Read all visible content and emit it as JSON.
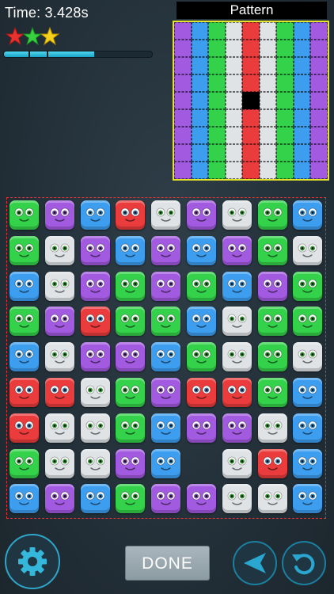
{
  "hud": {
    "timer": "Time: 3.428s",
    "stars": 3,
    "progress": 0.61
  },
  "pattern": {
    "title": "Pattern",
    "columns": [
      "purple",
      "blue",
      "green",
      "white",
      "red",
      "white",
      "green",
      "blue",
      "purple"
    ],
    "rows": 9,
    "empty_cell": [
      4,
      4
    ]
  },
  "board": {
    "empty_cells": [
      [
        7,
        5
      ]
    ],
    "grid": [
      [
        "green",
        "purple",
        "blue",
        "red",
        "white",
        "purple",
        "white",
        "green",
        "blue"
      ],
      [
        "green",
        "white",
        "purple",
        "blue",
        "purple",
        "blue",
        "purple",
        "green",
        "white"
      ],
      [
        "blue",
        "white",
        "purple",
        "green",
        "purple",
        "green",
        "blue",
        "purple",
        "green"
      ],
      [
        "green",
        "purple",
        "red",
        "green",
        "green",
        "blue",
        "white",
        "green",
        "green"
      ],
      [
        "blue",
        "white",
        "purple",
        "purple",
        "blue",
        "green",
        "white",
        "green",
        "white"
      ],
      [
        "red",
        "red",
        "white",
        "green",
        "purple",
        "red",
        "red",
        "green",
        "blue"
      ],
      [
        "red",
        "white",
        "white",
        "green",
        "blue",
        "purple",
        "purple",
        "white",
        "blue"
      ],
      [
        "green",
        "white",
        "white",
        "purple",
        "blue",
        "",
        "white",
        "red",
        "blue"
      ],
      [
        "blue",
        "purple",
        "blue",
        "green",
        "purple",
        "purple",
        "white",
        "white",
        "blue"
      ]
    ]
  },
  "colors": {
    "green": "#34d14a",
    "purple": "#a25ae0",
    "blue": "#3d9ef0",
    "red": "#ea3c3c",
    "white": "#dfe3e6",
    "accent": "#2fa6c9",
    "pattern_border": "#e4e42a"
  },
  "controls": {
    "done_label": "DONE",
    "settings_icon": "gear-icon",
    "send_icon": "arrow-left-icon",
    "undo_icon": "undo-icon"
  }
}
